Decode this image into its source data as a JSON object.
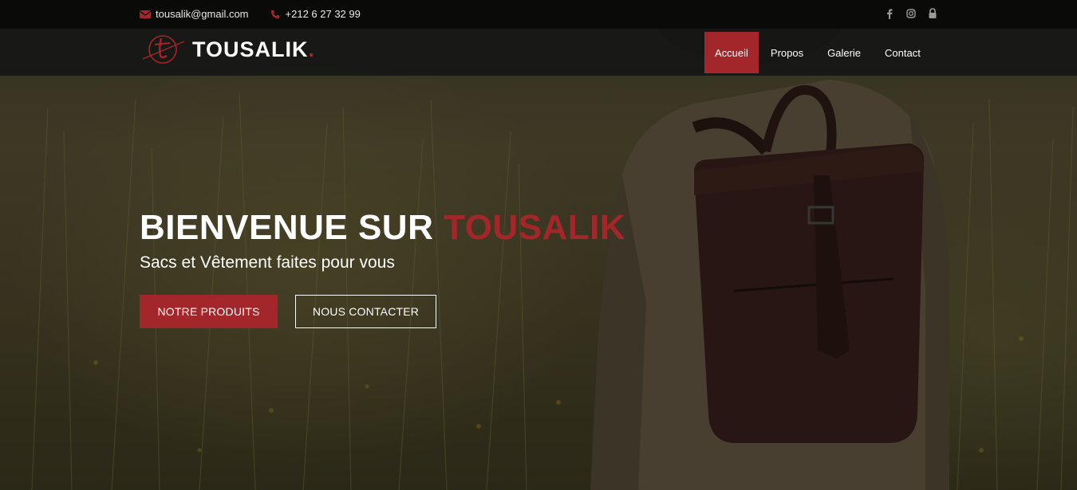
{
  "topbar": {
    "email": "tousalik@gmail.com",
    "phone": "+212 6 27 32 99",
    "email_icon": "envelope-icon",
    "phone_icon": "phone-icon",
    "social_icons": [
      "facebook-icon",
      "instagram-icon",
      "lock-icon"
    ]
  },
  "brand": {
    "name": "TOUSALIK",
    "dot": ".",
    "accent_color": "#a3262a"
  },
  "nav": {
    "items": [
      {
        "label": "Accueil",
        "active": true
      },
      {
        "label": "Propos",
        "active": false
      },
      {
        "label": "Galerie",
        "active": false
      },
      {
        "label": "Contact",
        "active": false
      }
    ]
  },
  "hero": {
    "title_prefix": "BIENVENUE SUR ",
    "title_brand": "TOUSALIK",
    "subtitle": "Sacs et Vêtement faites pour vous",
    "primary_button": "NOTRE PRODUITS",
    "secondary_button": "NOUS CONTACTER"
  }
}
